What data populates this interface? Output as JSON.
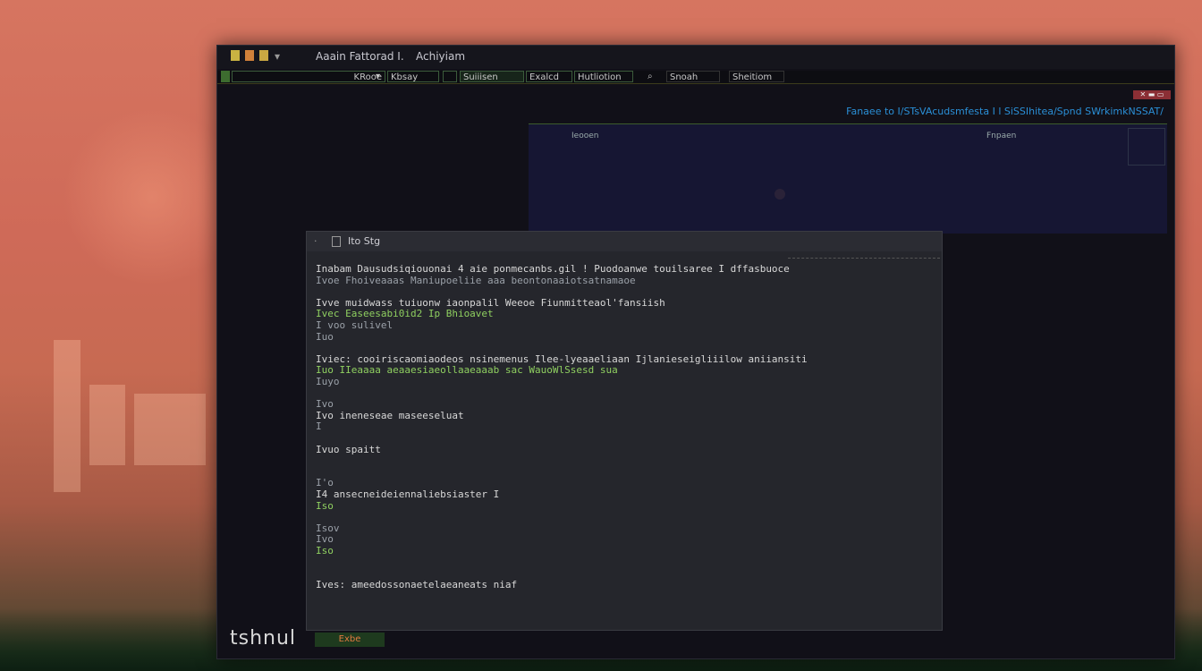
{
  "colors": {
    "accent_green": "#8fcf60",
    "accent_yellow": "#e8c95a",
    "accent_blue": "#2a8fd6",
    "close_red": "#8b2f35"
  },
  "window": {
    "title_left": "Aaain Fattorad I.",
    "title_right": "Achiyiam",
    "icons": [
      "app-icon-a",
      "app-icon-b",
      "app-icon-c"
    ]
  },
  "toolbar": {
    "buttons": [
      "KRooe",
      "Kbsay",
      "Suiiisen",
      "Exalcd",
      "Hutliotion",
      "Snoah",
      "Sheitiom"
    ]
  },
  "status": {
    "text": "Fanaee to I/STsVAcudsmfesta I l SiSSIhitea/Spnd SWrkimkNSSAT/"
  },
  "top_panel": {
    "left_label": "Ieooen",
    "right_label": "Fnpaen"
  },
  "editor": {
    "title": "Ito Stg",
    "lines": [
      {
        "text": "Inabam Dausudsiqiouonai 4 aie ponmecanbs.gil ! Puodoanwe touilsaree I dffasbuoce",
        "color": "c-white"
      },
      {
        "text": "Ivoe Fhoiveaaas Maniupoeliie aaa beontonaaiotsatnamaoe",
        "color": "c-dim"
      },
      {
        "text": "",
        "color": "c-dim"
      },
      {
        "text": "Ivve muidwass tuiuonw iaonpalil Weeoe Fiunmitteaol'fansiish",
        "color": "c-white"
      },
      {
        "text": "Ivec Easeesabi0id2 Ip Bhioavet",
        "color": "c-green"
      },
      {
        "text": "I voo sulivel",
        "color": "c-dim"
      },
      {
        "text": "Iuo",
        "color": "c-dim"
      },
      {
        "text": "",
        "color": "c-dim"
      },
      {
        "text": "Iviec: cooiriscaomiaodeos nsinemenus Ilee-lyeaaeliaan Ijlanieseigliiilow aniiansiti",
        "color": "c-white"
      },
      {
        "text": "Iuo IIeaaaa aeaaesiaeollaaeaaab sac WauoWlSsesd sua",
        "color": "c-green"
      },
      {
        "text": "Iuyo",
        "color": "c-dim"
      },
      {
        "text": "",
        "color": "c-dim"
      },
      {
        "text": "Ivo",
        "color": "c-dim"
      },
      {
        "text": "Ivo ineneseae maseeseluat",
        "color": "c-white"
      },
      {
        "text": "I",
        "color": "c-dim"
      },
      {
        "text": "",
        "color": "c-dim"
      },
      {
        "text": "Ivuo spaitt",
        "color": "c-white"
      },
      {
        "text": "",
        "color": "c-dim"
      },
      {
        "text": "",
        "color": "c-dim"
      },
      {
        "text": "I'o",
        "color": "c-dim"
      },
      {
        "text": "I4 ansecneideiennaliebsiaster I",
        "color": "c-white"
      },
      {
        "text": "Iso",
        "color": "c-green"
      },
      {
        "text": "",
        "color": "c-dim"
      },
      {
        "text": "Isov",
        "color": "c-dim"
      },
      {
        "text": "Ivo",
        "color": "c-dim"
      },
      {
        "text": "Iso",
        "color": "c-green"
      },
      {
        "text": "",
        "color": "c-dim"
      },
      {
        "text": "",
        "color": "c-dim"
      },
      {
        "text": "Ives: ameedossonaetelaeaneats niaf",
        "color": "c-white"
      }
    ]
  },
  "brand": {
    "name": "tshnul",
    "badge": "Exbe"
  }
}
